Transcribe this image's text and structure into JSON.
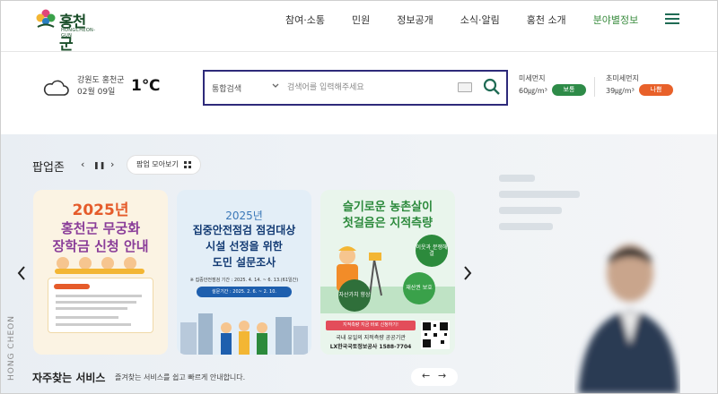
{
  "header": {
    "logo_ko": "홍천군",
    "logo_en": "HONGCHEON-GUN",
    "nav": [
      "참여·소통",
      "민원",
      "정보공개",
      "소식·알림",
      "홍천 소개",
      "분야별정보"
    ]
  },
  "weather": {
    "location": "강원도 홍천군",
    "date": "02월 09일",
    "temp": "1℃"
  },
  "search": {
    "category": "통합검색",
    "placeholder": "검색어를 입력해주세요"
  },
  "dust": [
    {
      "label": "미세먼지",
      "value": "60㎍/m³",
      "status": "보통",
      "color": "#2e8b48"
    },
    {
      "label": "초미세먼지",
      "value": "39㎍/m³",
      "status": "나쁨",
      "color": "#e8612a"
    }
  ],
  "popup": {
    "title": "팝업존",
    "prev": "‹",
    "pause": "❚❚",
    "next": "›",
    "more_label": "팝업 모아보기",
    "cards": [
      {
        "year": "2025년",
        "line1": "홍천군 무궁화",
        "line2": "장학금 신청 안내"
      },
      {
        "year": "2025년",
        "line1": "집중안전점검 점검대상",
        "line2": "시설 선정을 위한",
        "line3": "도민 설문조사",
        "period": "※ 집중안전점검 기간 : 2025. 4. 14. ~ 6. 13.(61일간)",
        "pill": "설문기간 : 2025. 2. 6. ~ 2. 10."
      },
      {
        "line1": "슬기로운 농촌살이",
        "line2": "첫걸음은 지적측량",
        "bubble1": "자산가치 향상",
        "bubble2": "이웃과 분쟁해결",
        "bubble3": "재산권 보호",
        "bar": "지적측량 지금 바로 신청하기!",
        "t1": "국내 유일의 지적측량 공공기관",
        "t2": "LX한국국토정보공사 1588-7704"
      }
    ]
  },
  "side_label": "HONG CHEON",
  "quick": {
    "title": "자주찾는 서비스",
    "desc": "즐겨찾는 서비스를 쉽고 빠르게 안내합니다."
  },
  "pager": {
    "prev": "←",
    "next": "→"
  }
}
